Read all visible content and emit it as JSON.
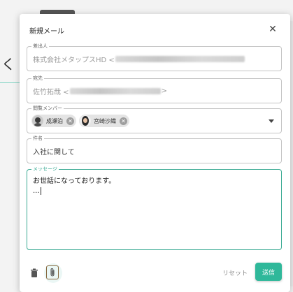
{
  "background": {
    "heading_fragment": "く ー"
  },
  "dialog": {
    "title": "新規メール",
    "fields": {
      "from": {
        "label": "差出人",
        "value": "株式会社メタップスHD <"
      },
      "to": {
        "label": "宛先",
        "value_prefix": "佐竹拓哉 <",
        "value_suffix": ">"
      },
      "viewers": {
        "label": "閲覧メンバー",
        "members": [
          {
            "name": "成瀬泊"
          },
          {
            "name": "宮崎沙織"
          }
        ]
      },
      "subject": {
        "label": "件名",
        "value": "入社に関して"
      },
      "message": {
        "label": "メッセージ",
        "line1": "お世話になっております。",
        "line2": "..."
      }
    },
    "footer": {
      "reset_label": "リセット",
      "send_label": "送信"
    }
  },
  "colors": {
    "accent": "#2fb89a",
    "focus_border": "#3aaa93",
    "attach_border": "#8b5a2b"
  },
  "icons": {
    "close": "close-icon",
    "trash": "trash-icon",
    "attach": "paperclip-icon",
    "dropdown": "chevron-down-icon",
    "remove_chip": "cancel-icon"
  }
}
